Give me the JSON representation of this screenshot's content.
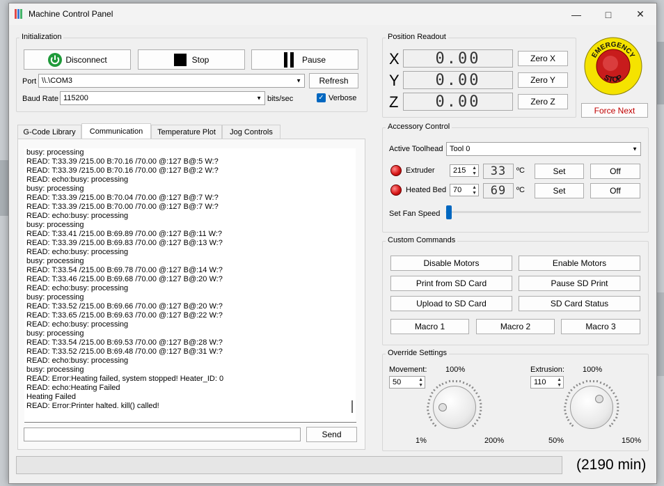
{
  "window": {
    "title": "Machine Control Panel"
  },
  "initialization": {
    "title": "Initialization",
    "disconnect_label": "Disconnect",
    "stop_label": "Stop",
    "pause_label": "Pause",
    "port_label": "Port",
    "port_value": "\\\\.\\COM3",
    "refresh_label": "Refresh",
    "baud_label": "Baud Rate",
    "baud_value": "115200",
    "baud_unit": "bits/sec",
    "verbose_label": "Verbose",
    "verbose_checked": true
  },
  "tabs": [
    {
      "label": "G-Code Library",
      "active": false
    },
    {
      "label": "Communication",
      "active": true
    },
    {
      "label": "Temperature Plot",
      "active": false
    },
    {
      "label": "Jog Controls",
      "active": false
    }
  ],
  "log": [
    "busy: processing",
    "READ:  T:33.39 /215.00 B:70.16 /70.00 @:127 B@:5 W:?",
    "READ:  T:33.39 /215.00 B:70.16 /70.00 @:127 B@:2 W:?",
    "READ: echo:busy: processing",
    "busy: processing",
    "READ:  T:33.39 /215.00 B:70.04 /70.00 @:127 B@:7 W:?",
    "READ:  T:33.39 /215.00 B:70.00 /70.00 @:127 B@:7 W:?",
    "READ: echo:busy: processing",
    "busy: processing",
    "READ:  T:33.41 /215.00 B:69.89 /70.00 @:127 B@:11 W:?",
    "READ:  T:33.39 /215.00 B:69.83 /70.00 @:127 B@:13 W:?",
    "READ: echo:busy: processing",
    "busy: processing",
    "READ:  T:33.54 /215.00 B:69.78 /70.00 @:127 B@:14 W:?",
    "READ:  T:33.46 /215.00 B:69.68 /70.00 @:127 B@:20 W:?",
    "READ: echo:busy: processing",
    "busy: processing",
    "READ:  T:33.52 /215.00 B:69.66 /70.00 @:127 B@:20 W:?",
    "READ:  T:33.65 /215.00 B:69.63 /70.00 @:127 B@:22 W:?",
    "READ: echo:busy: processing",
    "busy: processing",
    "READ:  T:33.54 /215.00 B:69.53 /70.00 @:127 B@:28 W:?",
    "READ:  T:33.52 /215.00 B:69.48 /70.00 @:127 B@:31 W:?",
    "READ: echo:busy: processing",
    "busy: processing",
    "READ: Error:Heating failed, system stopped! Heater_ID: 0",
    "READ: echo:Heating Failed",
    "Heating Failed",
    "READ: Error:Printer halted. kill() called!"
  ],
  "command_input": {
    "value": "",
    "send_label": "Send"
  },
  "position": {
    "title": "Position Readout",
    "x_label": "X",
    "x_value": "0.00",
    "zero_x": "Zero X",
    "y_label": "Y",
    "y_value": "0.00",
    "zero_y": "Zero Y",
    "z_label": "Z",
    "z_value": "0.00",
    "zero_z": "Zero Z"
  },
  "emergency": {
    "line1": "EMERGENCY",
    "line2": "STOP",
    "force_next": "Force Next"
  },
  "accessory": {
    "title": "Accessory Control",
    "toolhead_label": "Active Toolhead",
    "toolhead_value": "Tool 0",
    "extruder_label": "Extruder",
    "extruder_target": "215",
    "extruder_actual": "33",
    "bed_label": "Heated Bed",
    "bed_target": "70",
    "bed_actual": "69",
    "unit": "ºC",
    "set_label": "Set",
    "off_label": "Off",
    "fan_label": "Set Fan Speed",
    "fan_level": 0
  },
  "custom": {
    "title": "Custom Commands",
    "disable_motors": "Disable Motors",
    "enable_motors": "Enable Motors",
    "print_sd": "Print from SD Card",
    "pause_sd": "Pause SD Print",
    "upload_sd": "Upload to SD Card",
    "sd_status": "SD Card Status",
    "macro1": "Macro 1",
    "macro2": "Macro 2",
    "macro3": "Macro 3"
  },
  "override": {
    "title": "Override Settings",
    "movement_label": "Movement:",
    "movement_value": "50",
    "movement_center": "100%",
    "movement_min": "1%",
    "movement_max": "200%",
    "extrusion_label": "Extrusion:",
    "extrusion_value": "110",
    "extrusion_center": "100%",
    "extrusion_min": "50%",
    "extrusion_max": "150%"
  },
  "status": {
    "progress": 0,
    "time_remaining": "(2190 min)"
  }
}
